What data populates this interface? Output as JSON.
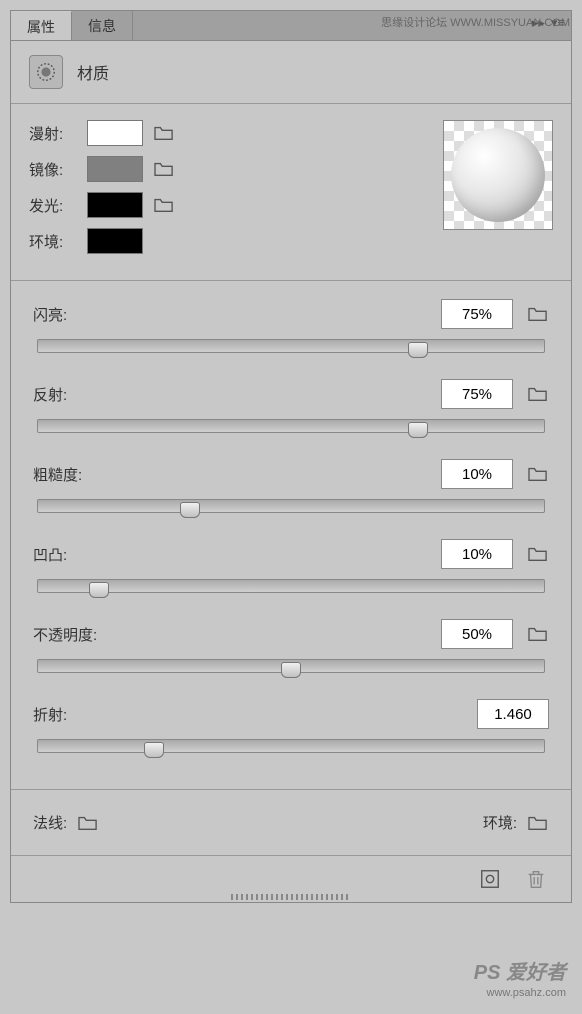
{
  "watermark_top": "思缘设计论坛  WWW.MISSYUAN.COM",
  "tabs": {
    "properties": "属性",
    "info": "信息"
  },
  "header": {
    "title": "材质"
  },
  "colors": {
    "diffuse": {
      "label": "漫射:",
      "value": "#ffffff"
    },
    "specular": {
      "label": "镜像:",
      "value": "#808080"
    },
    "glow": {
      "label": "发光:",
      "value": "#000000"
    },
    "ambient": {
      "label": "环境:",
      "value": "#000000"
    }
  },
  "sliders": {
    "shine": {
      "label": "闪亮:",
      "value": "75%",
      "percent": 75
    },
    "reflection": {
      "label": "反射:",
      "value": "75%",
      "percent": 75
    },
    "roughness": {
      "label": "粗糙度:",
      "value": "10%",
      "percent": 30
    },
    "bump": {
      "label": "凹凸:",
      "value": "10%",
      "percent": 12
    },
    "opacity": {
      "label": "不透明度:",
      "value": "50%",
      "percent": 50
    },
    "refraction": {
      "label": "折射:",
      "value": "1.460",
      "percent": 23
    }
  },
  "bottom": {
    "normal": "法线:",
    "environment": "环境:"
  },
  "watermark_bottom": {
    "logo": "PS 爱好者",
    "url": "www.psahz.com"
  }
}
